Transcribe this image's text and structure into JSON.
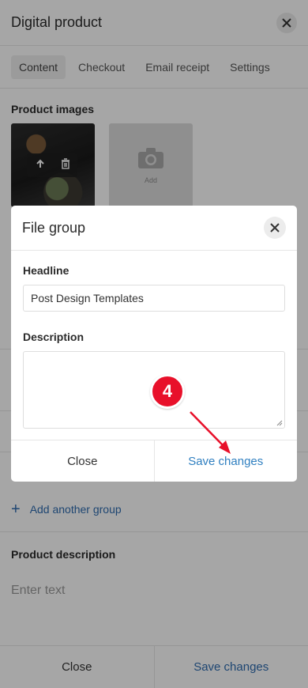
{
  "header": {
    "title": "Digital product"
  },
  "tabs": [
    {
      "label": "Content"
    },
    {
      "label": "Checkout"
    },
    {
      "label": "Email receipt"
    },
    {
      "label": "Settings"
    }
  ],
  "images_section": {
    "label": "Product images",
    "add_label": "Add"
  },
  "add_group": {
    "label": "Add another group"
  },
  "product_description": {
    "label": "Product description",
    "placeholder": "Enter text"
  },
  "footer": {
    "close_label": "Close",
    "save_label": "Save changes"
  },
  "modal": {
    "title": "File group",
    "headline_label": "Headline",
    "headline_value": "Post Design Templates",
    "description_label": "Description",
    "description_value": "",
    "close_label": "Close",
    "save_label": "Save changes"
  },
  "annotation": {
    "step": "4",
    "color": "#e8102a"
  },
  "colors": {
    "accent": "#2f7fc0",
    "link": "#2f6cb0",
    "overlay": "rgba(0,0,0,0.35)"
  }
}
